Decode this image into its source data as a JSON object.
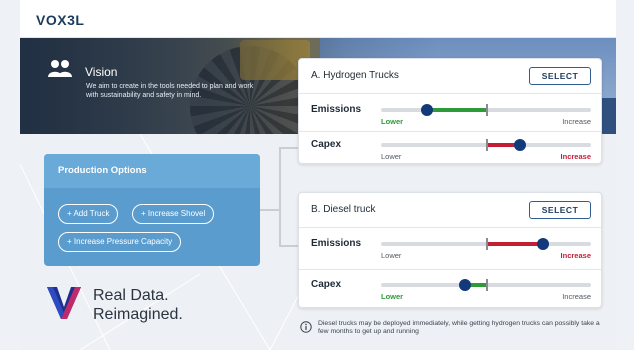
{
  "brand": {
    "logo": "VOX3L"
  },
  "vision": {
    "title": "Vision",
    "text": "We aim to create in the tools needed to plan and work with sustainability and safety in mind."
  },
  "production": {
    "title": "Production Options",
    "buttons": [
      "+ Add Truck",
      "+ Increase Shovel",
      "+ Increase Pressure Capacity"
    ]
  },
  "tagline": {
    "line1": "Real Data.",
    "line2": "Reimagined."
  },
  "options": [
    {
      "title": "A. Hydrogen Trucks",
      "select_label": "SELECT",
      "metrics": [
        {
          "label": "Emissions",
          "left": "Lower",
          "right": "Increase",
          "highlight": "left",
          "value": 0.22,
          "marker": 0.5
        },
        {
          "label": "Capex",
          "left": "Lower",
          "right": "Increase",
          "highlight": "right",
          "value": 0.66,
          "marker": 0.5
        }
      ]
    },
    {
      "title": "B. Diesel truck",
      "select_label": "SELECT",
      "metrics": [
        {
          "label": "Emissions",
          "left": "Lower",
          "right": "Increase",
          "highlight": "right",
          "value": 0.77,
          "marker": 0.5
        },
        {
          "label": "Capex",
          "left": "Lower",
          "right": "Increase",
          "highlight": "left",
          "value": 0.4,
          "marker": 0.5
        }
      ]
    }
  ],
  "note": "Diesel trucks may be deployed immediately, while getting hydrogen trucks can possibly take a few months to get up and running",
  "colors": {
    "green": "#2f9a3a",
    "red": "#c21f35",
    "knob": "#123a7a",
    "panel": "#5a9ccd"
  }
}
